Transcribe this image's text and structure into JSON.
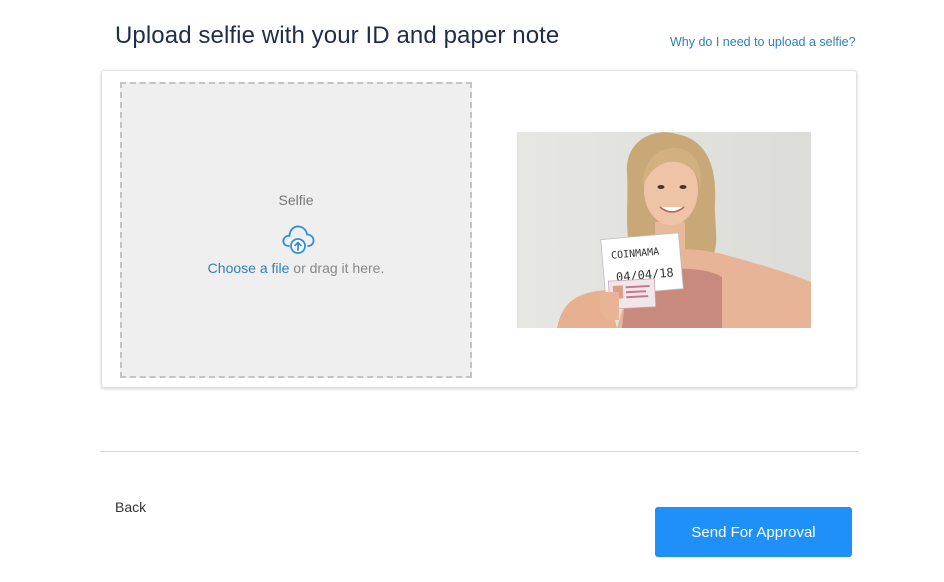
{
  "header": {
    "title": "Upload selfie with your ID and paper note",
    "help_link": "Why do I need to upload a selfie?"
  },
  "upload": {
    "label": "Selfie",
    "choose_file": "Choose a file",
    "drag_hint": " or drag it here."
  },
  "example_photo": {
    "note_line1": "COINMAMA",
    "note_line2": "04/04/18"
  },
  "footer": {
    "back_label": "Back",
    "send_label": "Send For Approval"
  },
  "colors": {
    "accent": "#1e90f7",
    "link": "#2f7fb8",
    "title": "#1f2d4a"
  }
}
